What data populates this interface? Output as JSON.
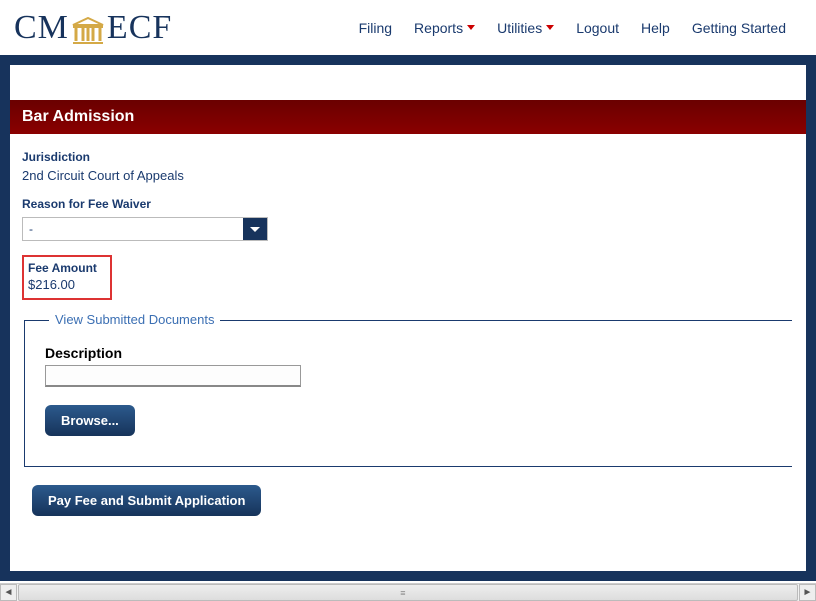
{
  "logo": {
    "part1": "CM",
    "part2": "ECF"
  },
  "nav": {
    "filing": "Filing",
    "reports": "Reports",
    "utilities": "Utilities",
    "logout": "Logout",
    "help": "Help",
    "getting_started": "Getting Started"
  },
  "banner": "Bar Admission",
  "jurisdiction": {
    "label": "Jurisdiction",
    "value": "2nd Circuit Court of Appeals"
  },
  "fee_waiver": {
    "label": "Reason for Fee Waiver",
    "selected": "-"
  },
  "fee_amount": {
    "label": "Fee Amount",
    "value": "$216.00"
  },
  "documents": {
    "legend": "View Submitted Documents",
    "description_label": "Description",
    "description_value": "",
    "browse": "Browse..."
  },
  "submit": "Pay Fee and Submit Application"
}
